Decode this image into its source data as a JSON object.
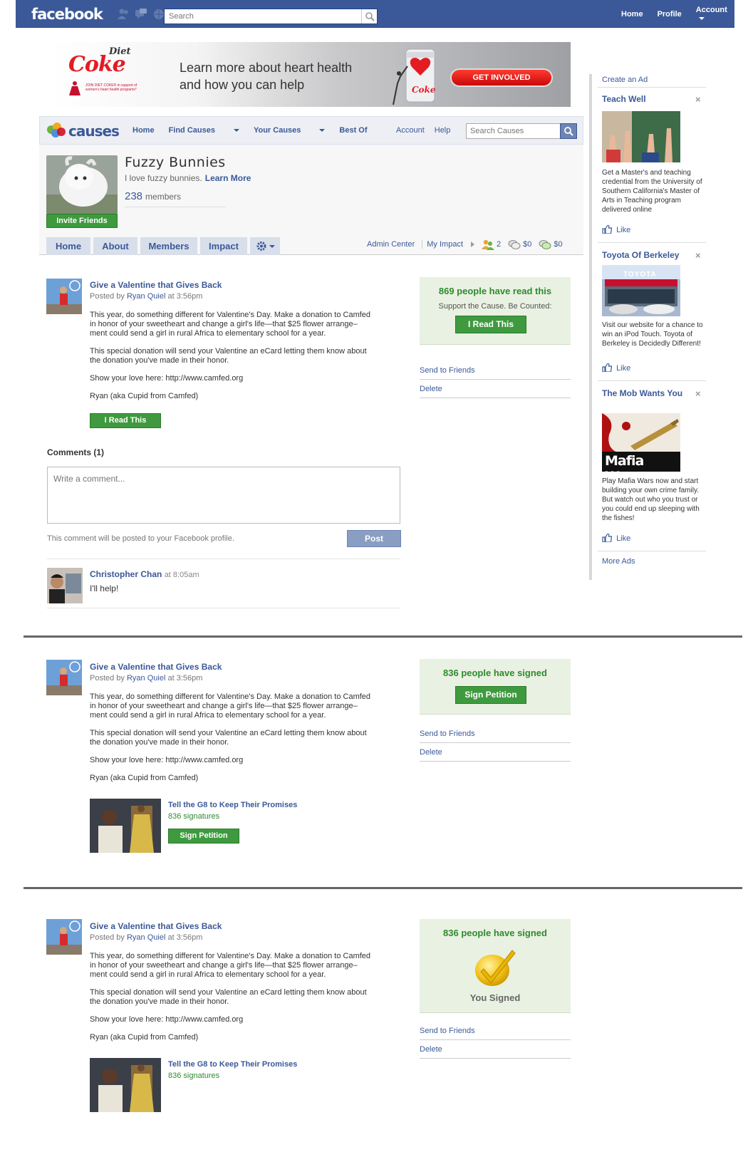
{
  "fb": {
    "logo": "facebook",
    "search_placeholder": "Search",
    "nav": {
      "home": "Home",
      "profile": "Profile",
      "account": "Account"
    }
  },
  "banner": {
    "brand_small": "Diet",
    "brand": "Coke",
    "fine_print": "JOIN DIET COKE® in support of women's heart health programs*",
    "line1": "Learn more about heart health",
    "line2": "and  how you can help",
    "cta": "GET INVOLVED"
  },
  "causes": {
    "logo": "causes",
    "nav": {
      "home": "Home",
      "find": "Find Causes",
      "yours": "Your Causes",
      "best": "Best Of"
    },
    "account": "Account",
    "help": "Help",
    "search_placeholder": "Search Causes",
    "name": "Fuzzy Bunnies",
    "tagline": "I love fuzzy bunnies.",
    "learn_more": "Learn More",
    "members_count": "238",
    "members_label": "members",
    "invite": "Invite Friends",
    "tabs": {
      "home": "Home",
      "about": "About",
      "members": "Members",
      "impact": "Impact"
    },
    "admin_center": "Admin Center",
    "my_impact": "My Impact",
    "impact_people": "2",
    "impact_dollars1": "$0",
    "impact_dollars2": "$0"
  },
  "post": {
    "title": "Give a Valentine that Gives Back",
    "posted_by": "Posted by",
    "author": "Ryan Quiel",
    "time": "at 3:56pm",
    "p1a": "This year, do something different for Valentine's Day. Make a donation to Camfed",
    "p1b": "in honor of your sweetheart and change a girl's life—that $25 flower arrange–",
    "p1c": "ment could send a girl in rural Africa to elementary school for a year.",
    "p2a": "This special donation will send your Valentine an eCard letting them know about",
    "p2b": "the donation you've made in their honor.",
    "p3": "Show your love here: http://www.camfed.org",
    "p4": "Ryan (aka Cupid from Camfed)"
  },
  "block1": {
    "read_btn": "I Read This",
    "side_head": "869 people have read this",
    "side_sub": "Support the Cause. Be Counted:",
    "side_btn": "I Read This",
    "send": "Send to Friends",
    "delete": "Delete",
    "comments_head": "Comments (1)",
    "comment_placeholder": "Write a comment...",
    "comment_note": "This comment will be posted to your Facebook profile.",
    "post_btn": "Post",
    "commenter": "Christopher Chan",
    "comment_time": "at 8:05am",
    "comment_text": "I'll help!"
  },
  "block2": {
    "side_head": "836 people have signed",
    "side_btn": "Sign Petition",
    "send": "Send to Friends",
    "delete": "Delete",
    "pet_title": "Tell the G8 to Keep Their Promises",
    "pet_sigs": "836 signatures",
    "pet_btn": "Sign Petition"
  },
  "block3": {
    "side_head": "836 people have signed",
    "signed": "You Signed",
    "send": "Send to Friends",
    "delete": "Delete",
    "pet_title": "Tell the G8 to Keep Their Promises",
    "pet_sigs": "836 signatures"
  },
  "ads": {
    "create": "Create an Ad",
    "more": "More Ads",
    "like": "Like",
    "ad1": {
      "title": "Teach Well",
      "text": "Get a Master's and teaching credential from the University of Southern California's Master of Arts in Teaching program delivered online"
    },
    "ad2": {
      "title": "Toyota Of Berkeley",
      "img_text": "TOYOTA",
      "text": "Visit our website for a chance to win an iPod Touch. Toyota of Berkeley is Decidedly Different!"
    },
    "ad3": {
      "title": "The Mob Wants You",
      "img_text": "Mafia Wars",
      "text": "Play Mafia Wars now and start building your own crime family. But watch out who you trust or you could end up sleeping with the fishes!"
    }
  },
  "colors": {
    "fb_blue": "#3b5998",
    "green": "#3f9a3f",
    "side_bg": "#e9f1e2"
  }
}
